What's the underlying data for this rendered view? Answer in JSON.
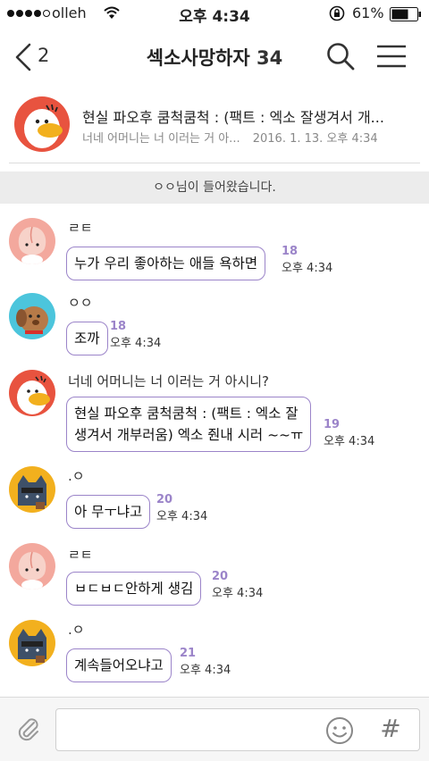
{
  "status_bar": {
    "carrier": "olleh",
    "time": "오후 4:34",
    "battery": "61%"
  },
  "header": {
    "back_count": "2",
    "title": "섹소사망하자",
    "member_count": "34"
  },
  "notice": {
    "title": "현실 파오후 쿰척쿰척 : (팩트 : 엑소 잘생겨서 개...",
    "preview": "너네 어머니는 너 이러는 거 아...",
    "date": "2016. 1. 13. 오후 4:34"
  },
  "system_message": "ㅇㅇ님이 들어왔습니다.",
  "messages": [
    {
      "sender": "ㄹㅌ",
      "avatar": "peach-avatar",
      "text": "누가 우리 좋아하는 애들 욕하면",
      "unread": "18",
      "time": "오후 4:34"
    },
    {
      "sender": "ㅇㅇ",
      "avatar": "dog-avatar",
      "text": "조까",
      "unread": "18",
      "time": "오후 4:34"
    },
    {
      "sender": "너네 어머니는 너 이러는 거 아시니?",
      "avatar": "duck-avatar",
      "text_line1": "현실 파오후 쿰척쿰척 : (팩트 : 엑소 잘",
      "text_line2": "생겨서 개부러움) 엑소 줜내 시러 ~~ㅠ",
      "unread": "19",
      "time": "오후 4:34"
    },
    {
      "sender": ".ㅇ",
      "avatar": "cat-avatar",
      "text": "아 무ㅜ냐고",
      "unread": "20",
      "time": "오후 4:34"
    },
    {
      "sender": "ㄹㅌ",
      "avatar": "peach-avatar",
      "text": "ㅂㄷㅂㄷ안하게 생김",
      "unread": "20",
      "time": "오후 4:34"
    },
    {
      "sender": ".ㅇ",
      "avatar": "cat-avatar",
      "text": "계속들어오냐고",
      "unread": "21",
      "time": "오후 4:34"
    }
  ],
  "input": {
    "value": "",
    "placeholder": ""
  },
  "icons": [
    "wifi-icon",
    "rotation-lock-icon",
    "battery-icon",
    "back-icon",
    "search-icon",
    "menu-icon",
    "paperclip-icon",
    "emoji-icon",
    "hash-icon"
  ],
  "colors": {
    "accent": "#9b84c9",
    "system_bg": "#ececec",
    "input_bar_bg": "#f6f6f6"
  }
}
